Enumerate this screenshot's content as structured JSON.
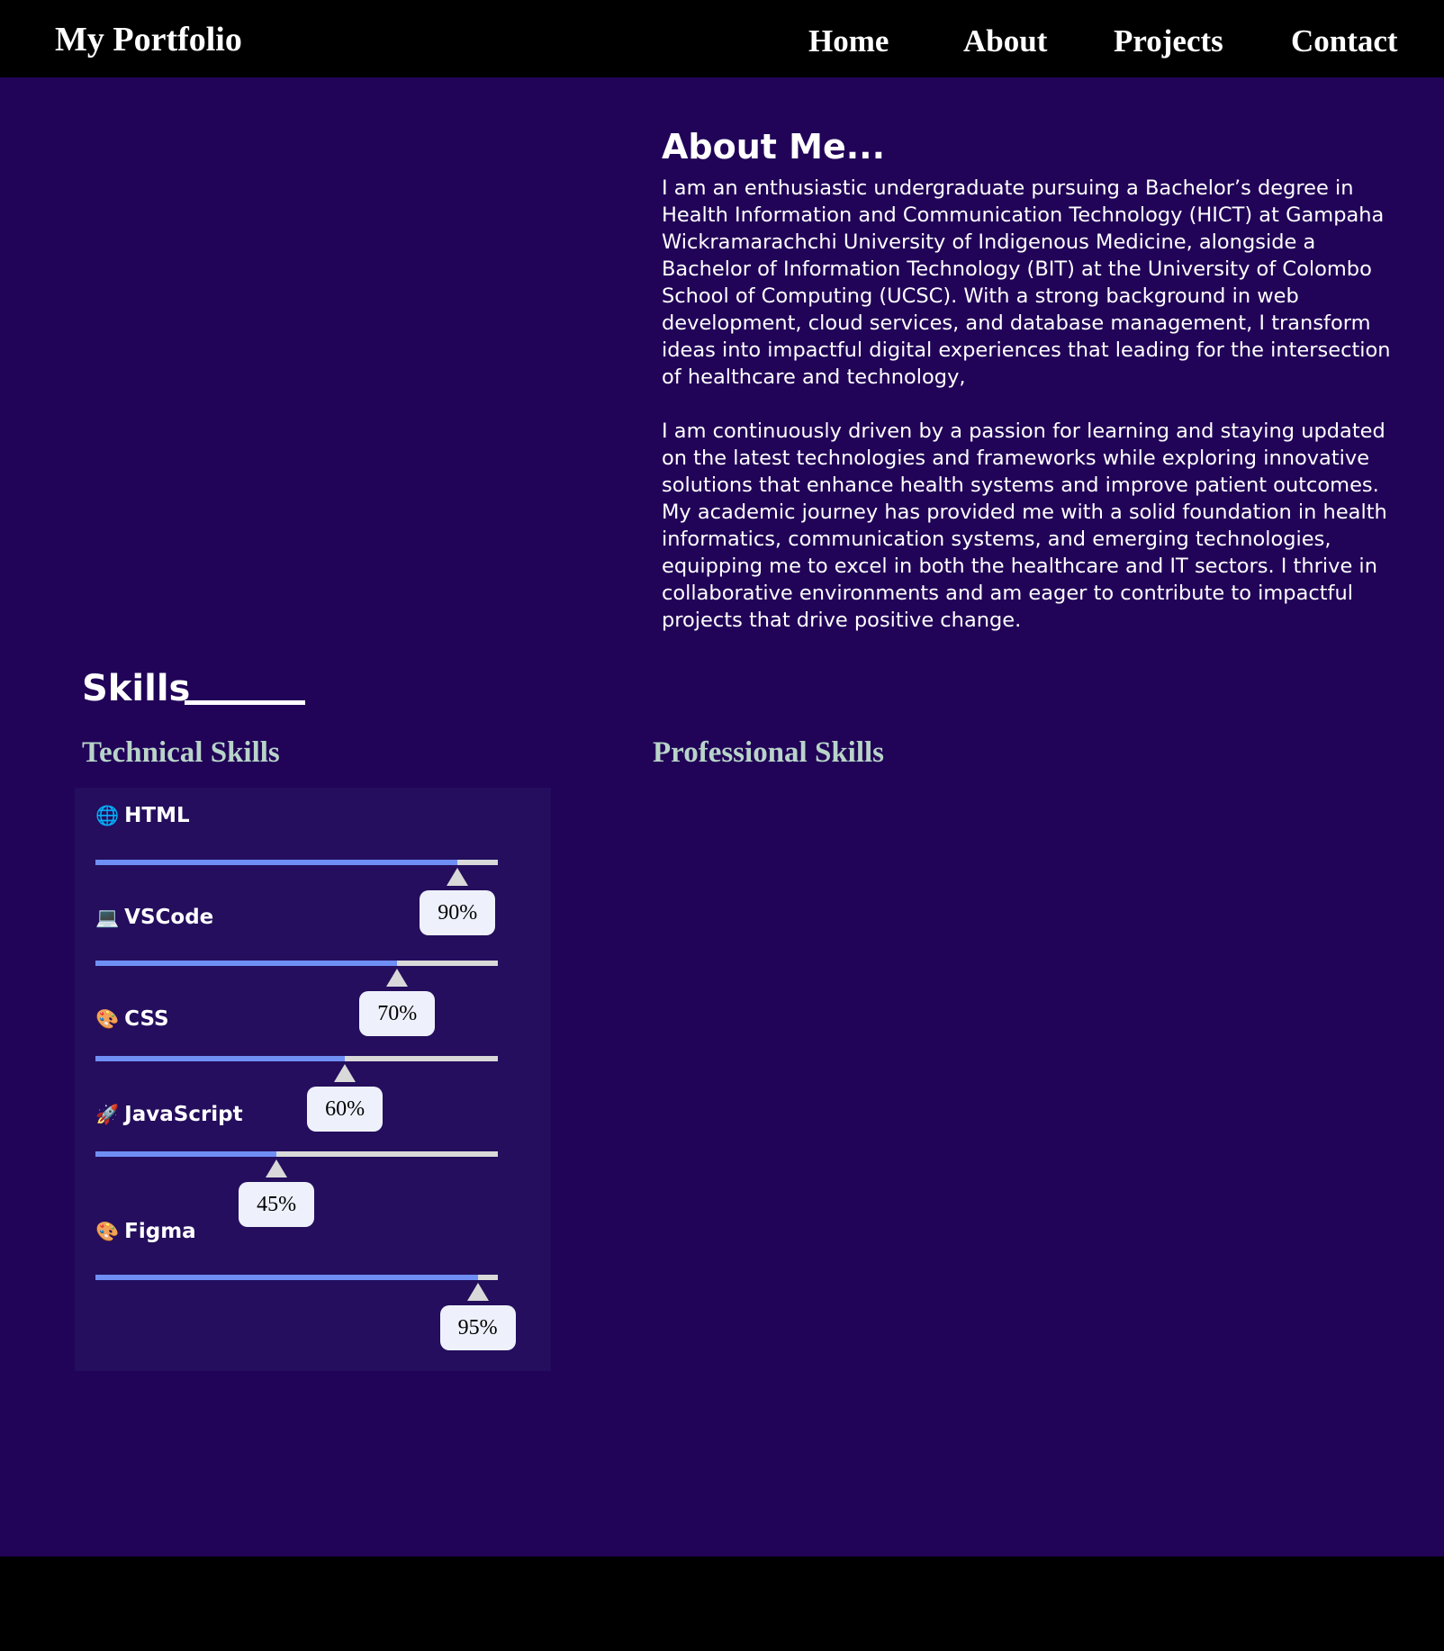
{
  "nav": {
    "brand": "My Portfolio",
    "links": [
      "Home",
      "About",
      "Projects",
      "Contact"
    ]
  },
  "about": {
    "title": "About Me...",
    "paragraphs": [
      "I am an enthusiastic undergraduate pursuing a Bachelor’s degree in Health Information and Communication Technology (HICT) at Gampaha Wickramarachchi University of Indigenous Medicine, alongside a Bachelor of Information Technology (BIT) at the University of Colombo School of Computing (UCSC). With a strong background in web development, cloud services, and database management, I transform ideas into impactful digital experiences that leading for the intersection of healthcare and technology,",
      "I am continuously driven by a passion for learning and staying updated on the latest technologies and frameworks while exploring innovative solutions that enhance health systems and improve patient outcomes. My academic journey has provided me with a solid foundation in health informatics, communication systems, and emerging technologies, equipping me to excel in both the healthcare and IT sectors. I thrive in collaborative environments and am eager to contribute to impactful projects that drive positive change."
    ]
  },
  "skills": {
    "title": "Skills",
    "technical_title": "Technical Skills",
    "professional_title": "Professional Skills",
    "technical": [
      {
        "name": "HTML",
        "icon": "globe-icon",
        "glyph": "🌐",
        "percent": 90,
        "label": "90%"
      },
      {
        "name": "VSCode",
        "icon": "laptop-icon",
        "glyph": "💻",
        "percent": 75,
        "label": "70%"
      },
      {
        "name": "CSS",
        "icon": "palette-icon",
        "glyph": "🎨",
        "percent": 62,
        "label": "60%"
      },
      {
        "name": "JavaScript",
        "icon": "rocket-icon",
        "glyph": "🚀",
        "percent": 45,
        "label": "45%"
      },
      {
        "name": "Figma",
        "icon": "palette-icon",
        "glyph": "🎨",
        "percent": 95,
        "label": "95%"
      }
    ]
  },
  "colors": {
    "background": "#210358",
    "navbar": "#000000",
    "panel": "#240e5d",
    "bar_fill": "#6f8ff5",
    "bar_track": "#d9d9d9",
    "subtitle": "#b8d4c8"
  }
}
